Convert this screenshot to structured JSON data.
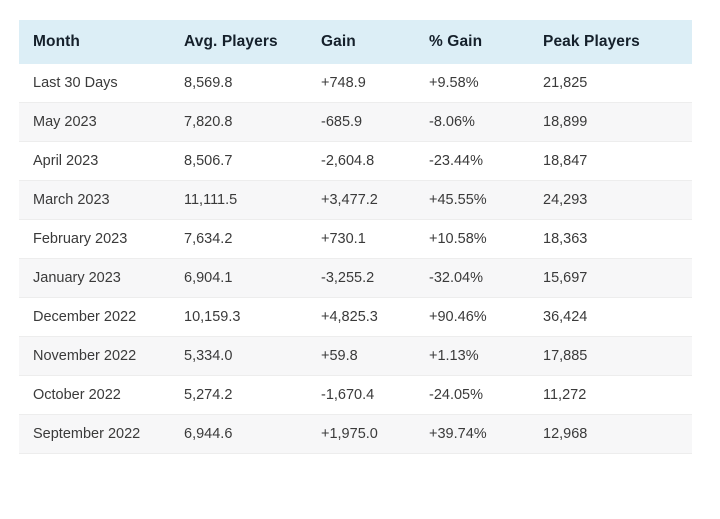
{
  "table": {
    "columns": [
      "Month",
      "Avg. Players",
      "Gain",
      "% Gain",
      "Peak Players"
    ],
    "header_background": "#dceef6",
    "header_text_color": "#15202b",
    "row_alt_background": "#f7f7f8",
    "row_text_color": "#3a3a3a",
    "rows": [
      {
        "month": "Last 30 Days",
        "avg_players": "8,569.8",
        "gain": "+748.9",
        "pct_gain": "+9.58%",
        "peak_players": "21,825"
      },
      {
        "month": "May 2023",
        "avg_players": "7,820.8",
        "gain": "-685.9",
        "pct_gain": "-8.06%",
        "peak_players": "18,899"
      },
      {
        "month": "April 2023",
        "avg_players": "8,506.7",
        "gain": "-2,604.8",
        "pct_gain": "-23.44%",
        "peak_players": "18,847"
      },
      {
        "month": "March 2023",
        "avg_players": "11,111.5",
        "gain": "+3,477.2",
        "pct_gain": "+45.55%",
        "peak_players": "24,293"
      },
      {
        "month": "February 2023",
        "avg_players": "7,634.2",
        "gain": "+730.1",
        "pct_gain": "+10.58%",
        "peak_players": "18,363"
      },
      {
        "month": "January 2023",
        "avg_players": "6,904.1",
        "gain": "-3,255.2",
        "pct_gain": "-32.04%",
        "peak_players": "15,697"
      },
      {
        "month": "December 2022",
        "avg_players": "10,159.3",
        "gain": "+4,825.3",
        "pct_gain": "+90.46%",
        "peak_players": "36,424"
      },
      {
        "month": "November 2022",
        "avg_players": "5,334.0",
        "gain": "+59.8",
        "pct_gain": "+1.13%",
        "peak_players": "17,885"
      },
      {
        "month": "October 2022",
        "avg_players": "5,274.2",
        "gain": "-1,670.4",
        "pct_gain": "-24.05%",
        "peak_players": "11,272"
      },
      {
        "month": "September 2022",
        "avg_players": "6,944.6",
        "gain": "+1,975.0",
        "pct_gain": "+39.74%",
        "peak_players": "12,968"
      }
    ]
  }
}
